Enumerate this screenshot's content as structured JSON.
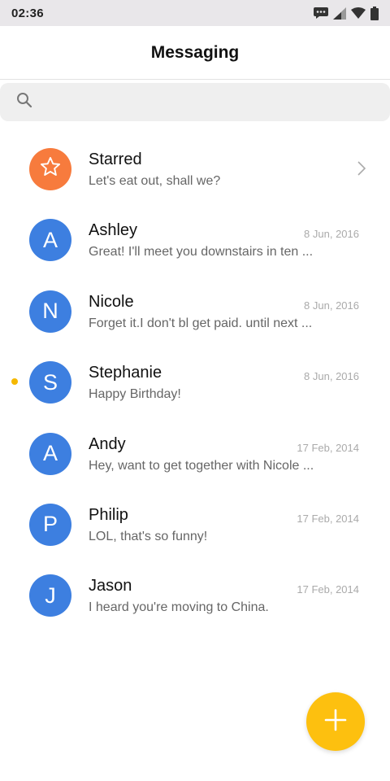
{
  "status_bar": {
    "time": "02:36",
    "icons": [
      "message-icon",
      "signal-icon",
      "wifi-icon",
      "battery-icon"
    ]
  },
  "header": {
    "title": "Messaging"
  },
  "search": {
    "placeholder": "",
    "icon": "search-icon"
  },
  "colors": {
    "avatar_blue": "#3d7fe0",
    "avatar_starred": "#f77b3d",
    "fab": "#fdc00f",
    "unread_dot": "#f5b800"
  },
  "conversations": [
    {
      "name": "Starred",
      "preview": "Let's eat out, shall we?",
      "date": "",
      "initial": "",
      "starred": true,
      "unread": false
    },
    {
      "name": "Ashley",
      "preview": "Great! I'll meet you downstairs in ten ...",
      "date": "8 Jun, 2016",
      "initial": "A",
      "unread": false
    },
    {
      "name": "Nicole",
      "preview": "Forget it.I don't bl get paid. until next ...",
      "date": "8 Jun, 2016",
      "initial": "N",
      "unread": false
    },
    {
      "name": "Stephanie",
      "preview": "Happy Birthday!",
      "date": "8 Jun, 2016",
      "initial": "S",
      "unread": true
    },
    {
      "name": "Andy",
      "preview": "Hey, want to get together with Nicole ...",
      "date": "17 Feb, 2014",
      "initial": "A",
      "unread": false
    },
    {
      "name": "Philip",
      "preview": "LOL, that's so funny!",
      "date": "17 Feb, 2014",
      "initial": "P",
      "unread": false
    },
    {
      "name": "Jason",
      "preview": "I heard you're moving to China.",
      "date": "17 Feb, 2014",
      "initial": "J",
      "unread": false
    }
  ],
  "fab": {
    "icon": "plus-icon"
  }
}
